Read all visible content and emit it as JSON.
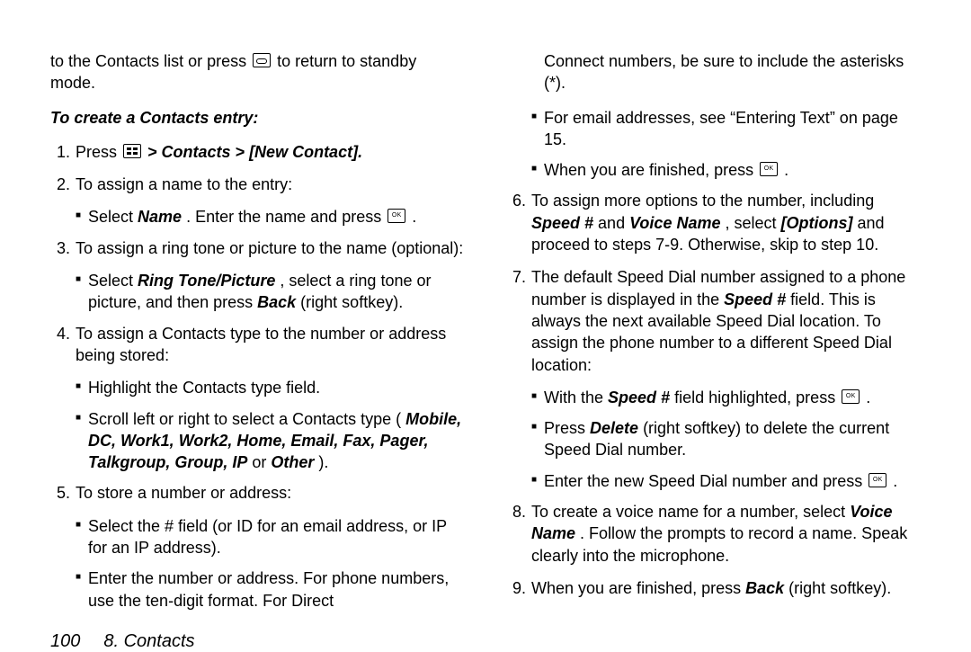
{
  "footer": {
    "page_number": "100",
    "chapter": "8. Contacts"
  },
  "icons": {
    "menu": "menu-key-icon",
    "ok": "ok-key-icon",
    "end": "end-key-icon"
  },
  "left": {
    "intro_a": "to the Contacts list or press ",
    "intro_b": " to return to standby mode.",
    "subhead": "To create a Contacts entry:",
    "s1_a": "Press ",
    "s1_b": " > Contacts > [New Contact].",
    "s2": "To assign a name to the entry:",
    "s2_b1_a": "Select ",
    "s2_b1_name": "Name",
    "s2_b1_b": ". Enter the name and press ",
    "s2_b1_c": ".",
    "s3": "To assign a ring tone or picture to the name (optional):",
    "s3_b1_a": "Select ",
    "s3_b1_rtp": "Ring Tone/Picture",
    "s3_b1_b": ", select a ring tone or picture, and then press ",
    "s3_b1_back": "Back",
    "s3_b1_c": " (right softkey).",
    "s4": "To assign a Contacts type to the number or address being stored:",
    "s4_b1": "Highlight the Contacts type field.",
    "s4_b2_a": "Scroll left or right to select a Contacts type (",
    "s4_b2_list": "Mobile, DC, Work1, Work2, Home, Email, Fax, Pager, Talkgroup, Group, IP",
    "s4_b2_or": " or ",
    "s4_b2_other": "Other",
    "s4_b2_b": ").",
    "s5": "To store a number or address:",
    "s5_b1": "Select the # field (or ID for an email address, or IP for an IP address).",
    "s5_b2": "Enter the number or address. For phone numbers, use the ten-digit format. For Direct"
  },
  "right": {
    "cont": "Connect numbers, be sure to include the asterisks (*).",
    "b_email": "For email addresses, see “Entering Text” on page 15.",
    "b_finish_a": "When you are finished, press ",
    "b_finish_b": ".",
    "s6_a": "To assign more options to the number, including ",
    "s6_speed": "Speed #",
    "s6_b": " and ",
    "s6_voice": "Voice Name",
    "s6_c": ", select ",
    "s6_opts": "[Options]",
    "s6_d": " and proceed to steps 7-9. Otherwise, skip to step 10.",
    "s7_a": "The default Speed Dial number assigned to a phone number is displayed in the ",
    "s7_speed": "Speed #",
    "s7_b": " field. This is always the next available Speed Dial location. To assign the phone number to a different Speed Dial location:",
    "s7_b1_a": "With the ",
    "s7_b1_speed": "Speed #",
    "s7_b1_b": " field highlighted, press ",
    "s7_b1_c": ".",
    "s7_b2_a": "Press ",
    "s7_b2_del": "Delete",
    "s7_b2_b": " (right softkey) to delete the current Speed Dial number.",
    "s7_b3_a": "Enter the new Speed Dial number and press ",
    "s7_b3_b": ".",
    "s8_a": "To create a voice name for a number, select ",
    "s8_voice": "Voice Name",
    "s8_b": ". Follow the prompts to record a name. Speak clearly into the microphone.",
    "s9_a": "When you are finished, press ",
    "s9_back": "Back",
    "s9_b": " (right softkey)."
  }
}
